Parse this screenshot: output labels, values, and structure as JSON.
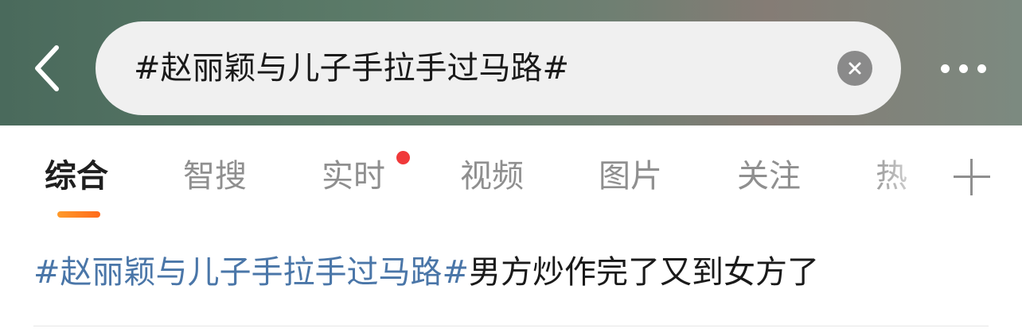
{
  "search": {
    "query": "#赵丽颖与儿子手拉手过马路#"
  },
  "tabs": [
    {
      "label": "综合"
    },
    {
      "label": "智搜"
    },
    {
      "label": "实时"
    },
    {
      "label": "视频"
    },
    {
      "label": "图片"
    },
    {
      "label": "关注"
    },
    {
      "label": "热"
    }
  ],
  "result": {
    "topic": "#赵丽颖与儿子手拉手过马路#",
    "text": "男方炒作完了又到女方了"
  },
  "icons": {
    "back": "back-chevron-icon",
    "clear": "clear-x-icon",
    "more": "more-dots-icon",
    "add_tab": "plus-icon"
  },
  "colors": {
    "accent_underline": "#ff7a1f",
    "topic_link": "#4a76a8",
    "notification_dot": "#f0393a"
  }
}
